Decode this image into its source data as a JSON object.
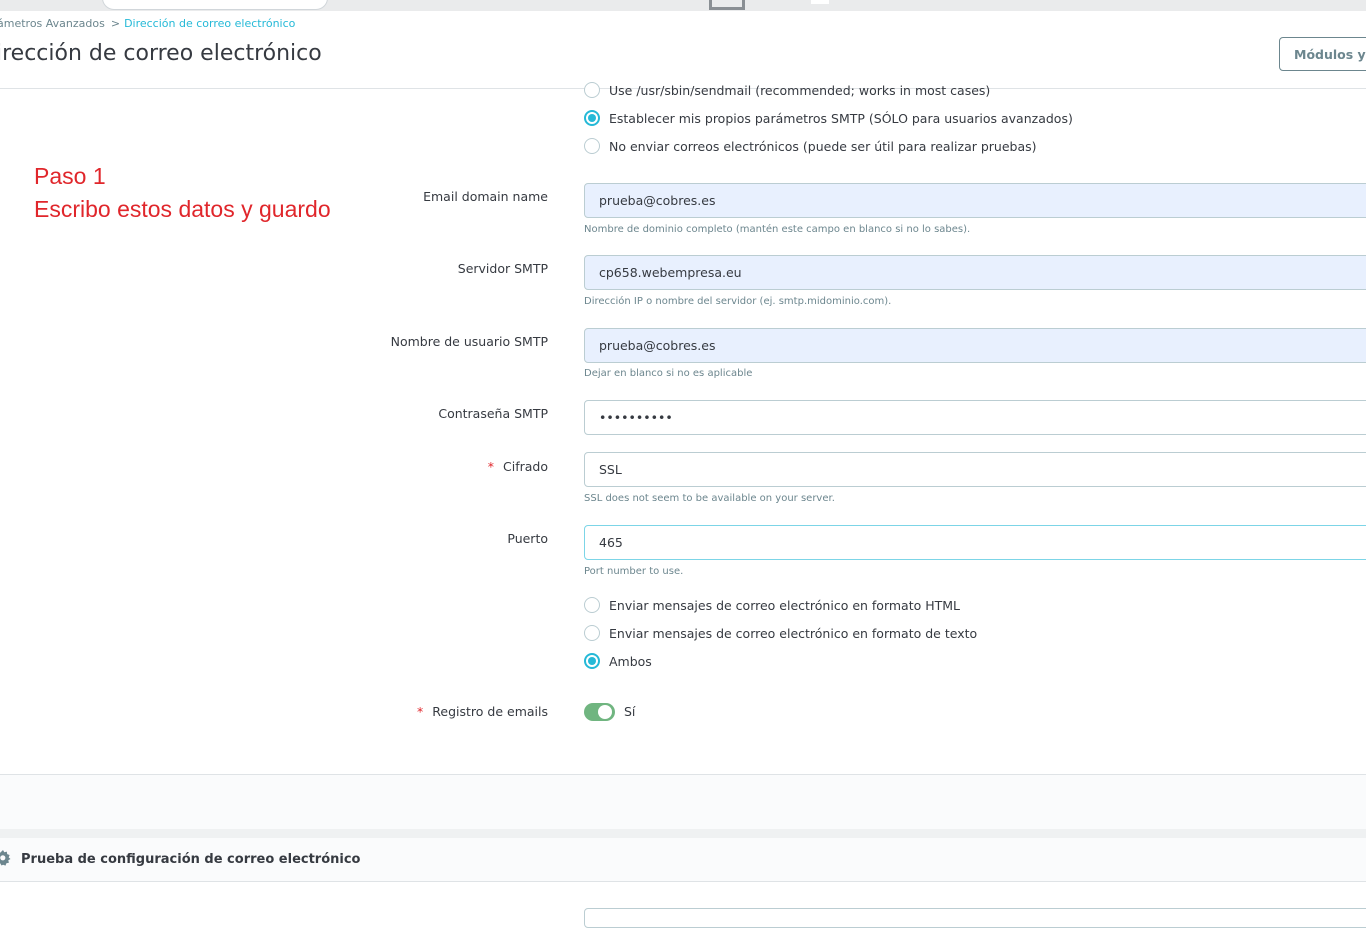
{
  "breadcrumb": {
    "parent": "ámetros Avanzados",
    "separator": ">",
    "current": "Dirección de correo electrónico"
  },
  "page": {
    "title": "irección de correo electrónico",
    "modules_button": "Módulos y S"
  },
  "annotation": {
    "line1": "Paso 1",
    "line2": "Escribo estos datos y guardo"
  },
  "mail_method": {
    "options": [
      {
        "label": "Use /usr/sbin/sendmail (recommended; works in most cases)",
        "checked": false
      },
      {
        "label": "Establecer mis propios parámetros SMTP (SÓLO para usuarios avanzados)",
        "checked": true
      },
      {
        "label": "No enviar correos electrónicos (puede ser útil para realizar pruebas)",
        "checked": false
      }
    ]
  },
  "fields": {
    "domain": {
      "label": "Email domain name",
      "value": "prueba@cobres.es",
      "help": "Nombre de dominio completo (mantén este campo en blanco si no lo sabes)."
    },
    "server": {
      "label": "Servidor SMTP",
      "value": "cp658.webempresa.eu",
      "help": "Dirección IP o nombre del servidor (ej. smtp.midominio.com)."
    },
    "user": {
      "label": "Nombre de usuario SMTP",
      "value": "prueba@cobres.es",
      "help": "Dejar en blanco si no es aplicable"
    },
    "password": {
      "label": "Contraseña SMTP",
      "value": "••••••••••"
    },
    "encryption": {
      "label": "Cifrado",
      "required_mark": "*",
      "value": "SSL",
      "help": "SSL does not seem to be available on your server."
    },
    "port": {
      "label": "Puerto",
      "value": "465",
      "help": "Port number to use."
    }
  },
  "format": {
    "options": [
      {
        "label": "Enviar mensajes de correo electrónico en formato HTML",
        "checked": false
      },
      {
        "label": "Enviar mensajes de correo electrónico en formato de texto",
        "checked": false
      },
      {
        "label": "Ambos",
        "checked": true
      }
    ]
  },
  "log": {
    "label": "Registro de emails",
    "required_mark": "*",
    "state_label": "Sí",
    "enabled": true
  },
  "test_panel": {
    "title": "Prueba de configuración de correo electrónico",
    "icon": "gear-icon"
  },
  "colors": {
    "accent": "#25b9d7",
    "annotation": "#e0262b",
    "switch_on": "#70b580",
    "required": "#e0262b"
  }
}
